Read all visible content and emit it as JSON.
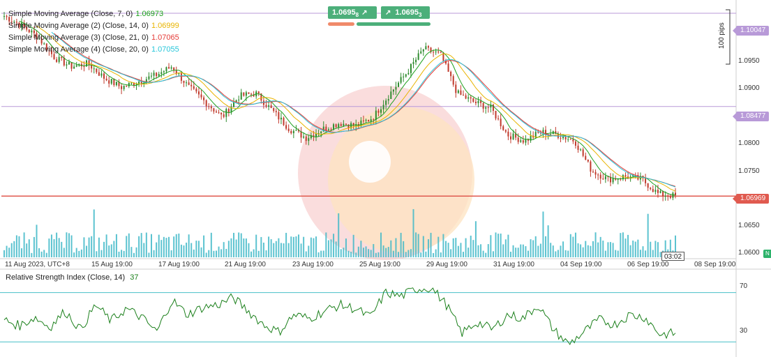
{
  "legend": [
    {
      "label": "Simple Moving Average (Close, 7, 0)",
      "value": "1.06973",
      "color": "#1ea01e"
    },
    {
      "label": "Simple Moving Average (2) (Close, 14, 0)",
      "value": "1.06999",
      "color": "#e8b400"
    },
    {
      "label": "Simple Moving Average (3) (Close, 21, 0)",
      "value": "1.07065",
      "color": "#e53935"
    },
    {
      "label": "Simple Moving Average (4) (Close, 20, 0)",
      "value": "1.07055",
      "color": "#26c6da"
    }
  ],
  "trade": {
    "sell_price": "1.0695",
    "sell_sup": "8",
    "buy_price": "1.0695",
    "buy_sup": "3",
    "sell_arrow": "↗",
    "buy_arrow": "↗"
  },
  "price_tags": [
    {
      "label": "1.10047",
      "price": 1.10047,
      "color": "#b89ad8"
    },
    {
      "label": "1.08477",
      "price": 1.08477,
      "color": "#b89ad8"
    },
    {
      "label": "1.06969",
      "price": 1.06969,
      "color": "#e05a4f"
    }
  ],
  "price_axis": [
    "1.0950",
    "1.0900",
    "1.0850",
    "1.0800",
    "1.0750",
    "1.0700",
    "1.0650",
    "1.0600"
  ],
  "time_axis": [
    "11 Aug 2023, UTC+8",
    "15 Aug 19:00",
    "17 Aug 19:00",
    "21 Aug 19:00",
    "23 Aug 19:00",
    "25 Aug 19:00",
    "29 Aug 19:00",
    "31 Aug 19:00",
    "04 Sep 19:00",
    "06 Sep 19:00",
    "08 Sep 19:00"
  ],
  "timer": "03:02",
  "pips": "100 pips",
  "rsi": {
    "label": "Relative Strength Index (Close, 14)",
    "value": "37",
    "levels": [
      "70",
      "30"
    ]
  },
  "edge_badge": "N",
  "colors": {
    "bull": "#2e8b2e",
    "bear": "#c0392b",
    "volume": "#3fb8c8",
    "rsi_line": "#1a7f1a",
    "rsi_level": "#48c0c8"
  },
  "chart_data": {
    "type": "candlestick",
    "title": "",
    "x": [
      "11 Aug 2023, UTC+8",
      "15 Aug 19:00",
      "17 Aug 19:00",
      "21 Aug 19:00",
      "23 Aug 19:00",
      "25 Aug 19:00",
      "29 Aug 19:00",
      "31 Aug 19:00",
      "04 Sep 19:00",
      "06 Sep 19:00"
    ],
    "close_path": [
      1.1,
      1.0985,
      1.0965,
      1.093,
      1.0915,
      1.092,
      1.0895,
      1.088,
      1.089,
      1.09,
      1.0915,
      1.088,
      1.0855,
      1.083,
      1.0865,
      1.087,
      1.084,
      1.081,
      1.0795,
      1.081,
      1.082,
      1.0815,
      1.083,
      1.087,
      1.0905,
      1.0945,
      1.0935,
      1.087,
      1.0855,
      1.0845,
      1.08,
      1.079,
      1.0805,
      1.08,
      1.079,
      1.074,
      1.0725,
      1.073,
      1.0725,
      1.07,
      1.0697
    ],
    "ylim": [
      1.0595,
      1.102
    ],
    "horizontal_lines": [
      1.10047,
      1.08477,
      1.06969
    ],
    "rsi": {
      "ylim": [
        20,
        80
      ],
      "levels": [
        70,
        30
      ],
      "values": [
        48,
        43,
        50,
        42,
        55,
        40,
        60,
        47,
        57,
        50,
        38,
        64,
        52,
        58,
        60,
        66,
        55,
        44,
        38,
        52,
        49,
        55,
        60,
        57,
        50,
        70,
        67,
        73,
        74,
        60,
        37,
        46,
        40,
        52,
        49,
        60,
        40,
        28,
        38,
        48,
        44,
        52,
        50,
        36,
        37
      ]
    }
  }
}
